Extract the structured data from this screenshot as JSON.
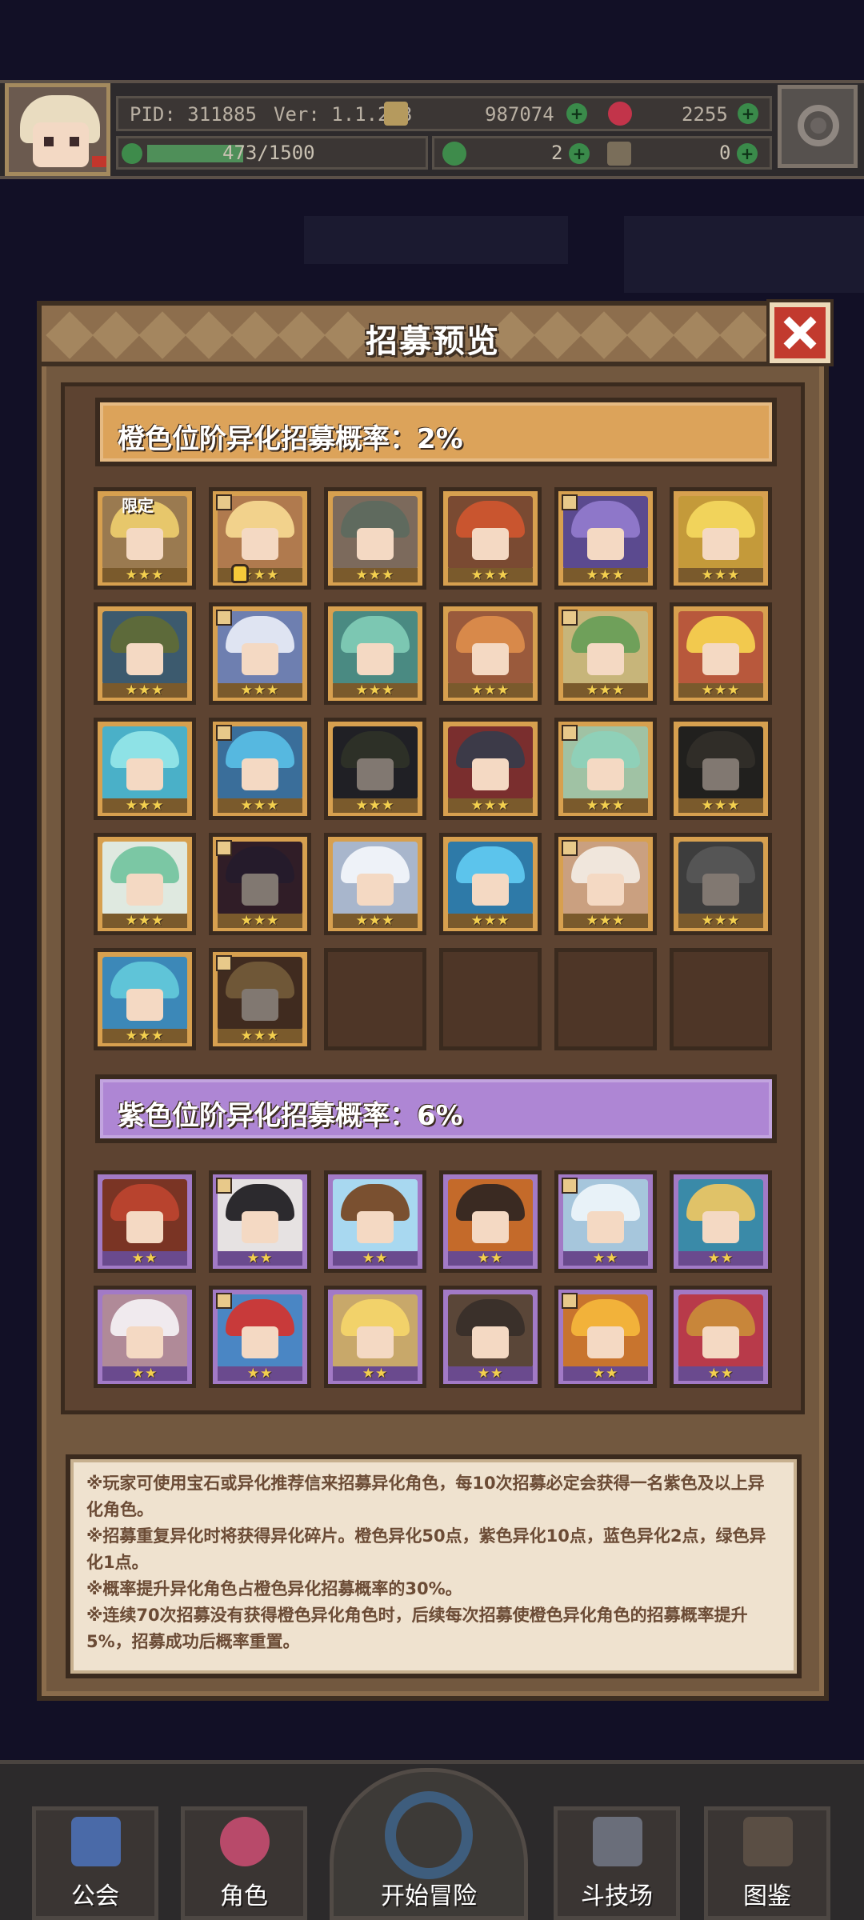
{
  "header": {
    "pid": "PID: 311885",
    "version": "Ver: 1.1.2.3",
    "gold": "987074",
    "gems": "2255",
    "exp": "473/1500",
    "clover": "2",
    "boots": "0"
  },
  "modal": {
    "title": "招募预览",
    "orange_band": "橙色位阶异化招募概率：2%",
    "purple_band": "紫色位阶异化招募概率：6%",
    "limited_tag": "限定",
    "orange_stars": "★★★",
    "purple_stars": "★★",
    "orange_cards": [
      {
        "id": "o1",
        "limited": true,
        "hair": "#e7c76b",
        "bg": "#9a7a50"
      },
      {
        "id": "o2",
        "hair": "#f2d28c",
        "bg": "#b07a4e"
      },
      {
        "id": "o3",
        "hair": "#5f6a5e",
        "bg": "#7c6a5c"
      },
      {
        "id": "o4",
        "hair": "#c9552f",
        "bg": "#7a4a32"
      },
      {
        "id": "o5",
        "hair": "#8e77c9",
        "bg": "#5b4a8f"
      },
      {
        "id": "o6",
        "hair": "#f1d35b",
        "bg": "#c49a3a"
      },
      {
        "id": "o7",
        "hair": "#5d6a3a",
        "bg": "#3c5a6e"
      },
      {
        "id": "o8",
        "hair": "#dfe4f2",
        "bg": "#6e7fb0"
      },
      {
        "id": "o9",
        "hair": "#7cc7b2",
        "bg": "#4a8a82"
      },
      {
        "id": "o10",
        "hair": "#d8894a",
        "bg": "#9a5a3c"
      },
      {
        "id": "o11",
        "hair": "#6fa05a",
        "bg": "#c7b57a"
      },
      {
        "id": "o12",
        "hair": "#f2c94e",
        "bg": "#b8583c"
      },
      {
        "id": "o13",
        "hair": "#8ee2e6",
        "bg": "#4ab0c8"
      },
      {
        "id": "o14",
        "hair": "#56b8e0",
        "bg": "#3a6e9a"
      },
      {
        "id": "o15",
        "hair": "#4e5a3e",
        "bg": "#3a3a4a",
        "dark": true
      },
      {
        "id": "o16",
        "hair": "#3c3a48",
        "bg": "#7a2e2e"
      },
      {
        "id": "o17",
        "hair": "#8fd0b8",
        "bg": "#a0c2a4"
      },
      {
        "id": "o18",
        "hair": "#5a5242",
        "bg": "#3e3a34",
        "dark": true
      },
      {
        "id": "o19",
        "hair": "#7bc7a4",
        "bg": "#dfe9e0"
      },
      {
        "id": "o20",
        "hair": "#4c2e5e",
        "bg": "#6a2e4e",
        "dark": true
      },
      {
        "id": "o21",
        "hair": "#eef2f8",
        "bg": "#a8b6cc"
      },
      {
        "id": "o22",
        "hair": "#5cc4ec",
        "bg": "#2e7aa8"
      },
      {
        "id": "o23",
        "hair": "#f0e6dc",
        "bg": "#caa080"
      },
      {
        "id": "o24",
        "hair": "#9a9a9a",
        "bg": "#6e6e6e",
        "dark": true
      },
      {
        "id": "o25",
        "hair": "#5fc4d8",
        "bg": "#3c88b8"
      },
      {
        "id": "o26",
        "hair": "#e59a3a",
        "bg": "#8a4a24",
        "dark": true
      }
    ],
    "purple_cards": [
      {
        "id": "p1",
        "hair": "#b8432e",
        "bg": "#7a3424"
      },
      {
        "id": "p2",
        "hair": "#2c2a2e",
        "bg": "#e6e2e2"
      },
      {
        "id": "p3",
        "hair": "#7a5030",
        "bg": "#a8d8f0"
      },
      {
        "id": "p4",
        "hair": "#3a2a22",
        "bg": "#c46a2a"
      },
      {
        "id": "p5",
        "hair": "#e8f2f8",
        "bg": "#a6c6dc"
      },
      {
        "id": "p6",
        "hair": "#e0c268",
        "bg": "#3a8aa8"
      },
      {
        "id": "p7",
        "hair": "#f0eaee",
        "bg": "#b08a98"
      },
      {
        "id": "p8",
        "hair": "#c83a3a",
        "bg": "#4a86c4"
      },
      {
        "id": "p9",
        "hair": "#f2d26a",
        "bg": "#c8a86a"
      },
      {
        "id": "p10",
        "hair": "#3a302a",
        "bg": "#5a4638"
      },
      {
        "id": "p11",
        "hair": "#f2b23a",
        "bg": "#c8742e"
      },
      {
        "id": "p12",
        "hair": "#c8863a",
        "bg": "#b83a4a"
      }
    ],
    "notes": [
      "※玩家可使用宝石或异化推荐信来招募异化角色，每10次招募必定会获得一名紫色及以上异化角色。",
      "※招募重复异化时将获得异化碎片。橙色异化50点，紫色异化10点，蓝色异化2点，绿色异化1点。",
      "※概率提升异化角色占橙色异化招募概率的30%。",
      "※连续70次招募没有获得橙色异化角色时，后续每次招募使橙色异化角色的招募概率提升5%，招募成功后概率重置。"
    ]
  },
  "nav": {
    "guild": "公会",
    "character": "角色",
    "adventure": "开始冒险",
    "arena": "斗技场",
    "codex": "图鉴"
  },
  "colors": {
    "orange_band": "#dca35a",
    "purple_band": "#ae86d4",
    "modal_bg": "#72583f",
    "accent_close": "#c23a2e"
  }
}
